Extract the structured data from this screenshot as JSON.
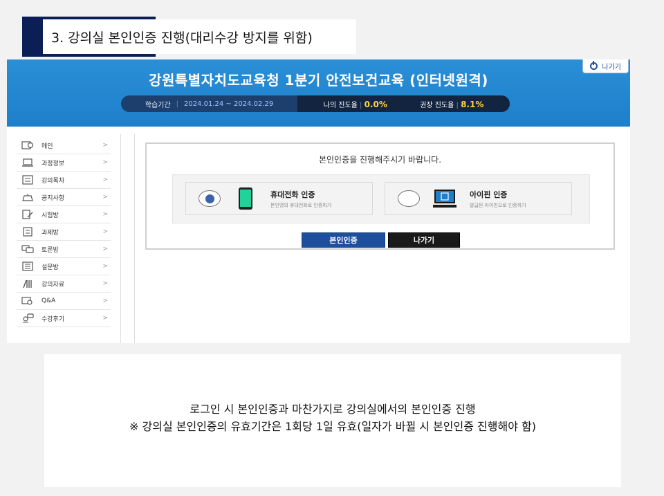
{
  "slide": {
    "title": "3. 강의실 본인인증 진행(대리수강 방지를 위함)",
    "caption_line1": "로그인 시 본인인증과 마찬가지로 강의실에서의 본인인증 진행",
    "caption_line2": "※ 강의실 본인인증의 유효기간은 1회당 1일 유효(일자가 바뀔 시 본인인증 진행해야 함)"
  },
  "header": {
    "course_title": "강원특별자치도교육청 1분기 안전보건교육 (인터넷원격)",
    "exit_label": "나가기",
    "period_label": "학습기간",
    "period_value": "2024.01.24 ~ 2024.02.29",
    "my_progress_label": "나의 진도율",
    "my_progress_value": "0.0%",
    "recommended_progress_label": "권장 진도율",
    "recommended_progress_value": "8.1%"
  },
  "sidebar": {
    "items": [
      {
        "label": "메인",
        "icon": "home-icon"
      },
      {
        "label": "과정정보",
        "icon": "laptop-icon"
      },
      {
        "label": "강의목차",
        "icon": "list-icon"
      },
      {
        "label": "공지사항",
        "icon": "megaphone-icon"
      },
      {
        "label": "시험방",
        "icon": "pencil-icon"
      },
      {
        "label": "과제방",
        "icon": "document-icon"
      },
      {
        "label": "토론방",
        "icon": "chat-icon"
      },
      {
        "label": "설문방",
        "icon": "survey-icon"
      },
      {
        "label": "강의자료",
        "icon": "books-icon"
      },
      {
        "label": "Q&A",
        "icon": "qa-icon"
      },
      {
        "label": "수강후기",
        "icon": "review-icon"
      }
    ],
    "chevron": ">"
  },
  "auth": {
    "message": "본인인증을 진행해주시기 바랍니다.",
    "phone_title": "휴대전화 인증",
    "phone_sub": "본인명의 휴대전화로 인증하기",
    "ipin_title": "아이핀 인증",
    "ipin_sub": "발급된 아이핀으로 인증하기",
    "auth_button": "본인인증",
    "exit_button": "나가기"
  },
  "colors": {
    "navy": "#0b1f56",
    "banner_blue": "#1e7fcb",
    "progress_yellow": "#ffd43b",
    "auth_button_blue": "#1d4f9c",
    "phone_screen_green": "#1fd39a"
  }
}
